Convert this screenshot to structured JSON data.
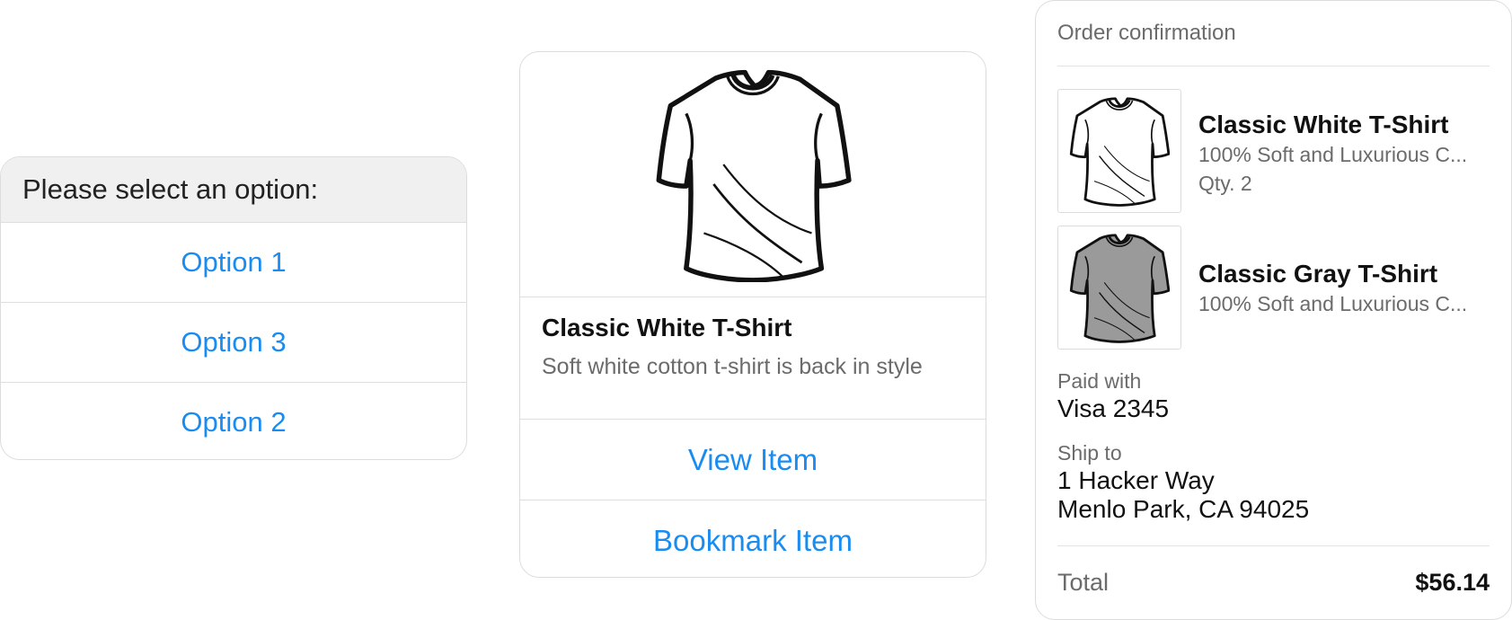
{
  "options_card": {
    "prompt": "Please select an option:",
    "options": [
      "Option 1",
      "Option 3",
      "Option 2"
    ]
  },
  "product_card": {
    "title": "Classic White T-Shirt",
    "description": "Soft white cotton t-shirt is back in style",
    "image_icon": "tshirt-white-icon",
    "buttons": [
      "View Item",
      "Bookmark Item"
    ]
  },
  "order_card": {
    "heading": "Order confirmation",
    "items": [
      {
        "name": "Classic White T-Shirt",
        "subtitle": "100% Soft and Luxurious C...",
        "qty": "Qty. 2",
        "icon": "tshirt-white-icon",
        "color": "#ffffff"
      },
      {
        "name": "Classic Gray T-Shirt",
        "subtitle": "100% Soft and Luxurious C...",
        "icon": "tshirt-gray-icon",
        "color": "#9a9a9a"
      }
    ],
    "paid_with_label": "Paid with",
    "paid_with": "Visa 2345",
    "ship_to_label": "Ship to",
    "ship_to_line1": "1 Hacker Way",
    "ship_to_line2": "Menlo Park, CA 94025",
    "total_label": "Total",
    "total_value": "$56.14"
  },
  "colors": {
    "accent": "#1a8cf0",
    "muted_text": "#6b6b6b",
    "prompt_bg": "#f0f0f0",
    "border": "#dcdcdc"
  }
}
